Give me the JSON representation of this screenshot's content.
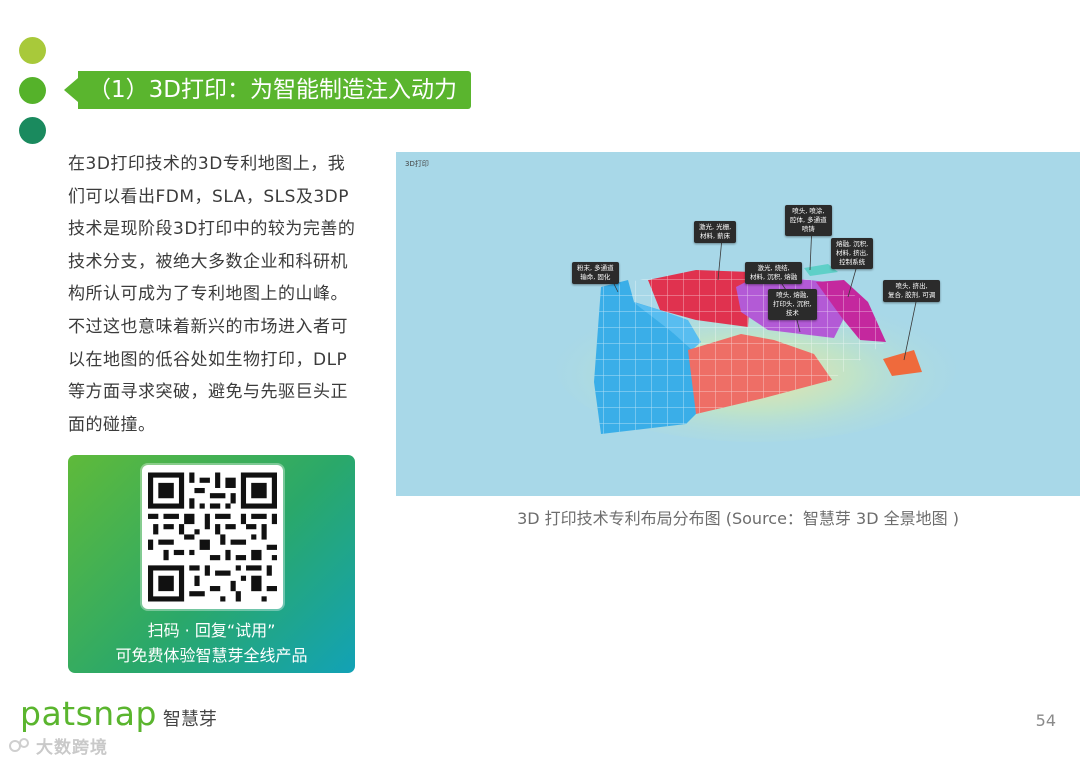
{
  "slide": {
    "title": "（1）3D打印：为智能制造注入动力",
    "body": "在3D打印技术的3D专利地图上，我们可以看出FDM，SLA，SLS及3DP技术是现阶段3D打印中的较为完善的技术分支，被绝大多数企业和科研机构所认可成为了专利地图上的山峰。不过这也意味着新兴的市场进入者可以在地图的低谷处如生物打印，DLP等方面寻求突破，避免与先驱巨头正面的碰撞。",
    "page_number": "54"
  },
  "qr_card": {
    "line1": "扫码 · 回复“试用”",
    "line2": "可免费体验智慧芽全线产品"
  },
  "figure": {
    "corner_label": "3D打印",
    "caption": "3D 打印技术专利布局分布图 (Source：智慧芽 3D 全景地图 )",
    "labels": [
      "粉末, 多通道\n输命, 固化",
      "激光, 光栅,\n材料, 薪床",
      "喷头, 喷涂,\n腔体, 多通道\n喷铸",
      "激光, 烧结,\n材料, 沉积, 熔融",
      "熔融, 沉积,\n材料, 挤出,\n控制系统",
      "喷头, 熔融,\n打印头, 沉积,\n技术",
      "喷头, 挤出,\n复合, 胶剂, 可调"
    ],
    "colors": {
      "background": "#a8d8e8",
      "blue_region": "#3aaee8",
      "red_region": "#e0324f",
      "salmon_region": "#ee6e66",
      "purple_region": "#b35ad6",
      "magenta_region": "#c4289e",
      "orange_region": "#ef6a3c"
    }
  },
  "brand": {
    "name_en": "patsnap",
    "name_cn": "智慧芽"
  },
  "watermark": "大数跨境",
  "colors": {
    "accent_green": "#5ab52e",
    "dot_1": "#a8c93a",
    "dot_2": "#55b22a",
    "dot_3": "#1a8a5e"
  }
}
